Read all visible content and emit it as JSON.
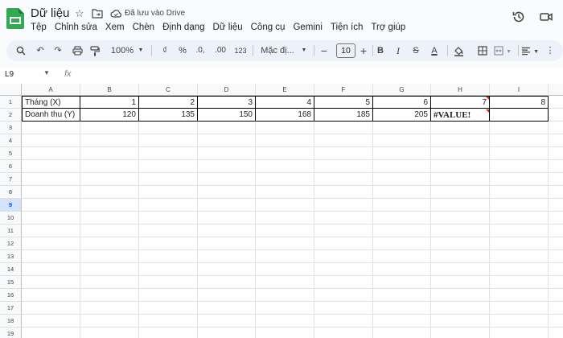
{
  "app": {
    "title": "Dữ liệu",
    "saved_status": "Đã lưu vào Drive",
    "icons": [
      "star-icon",
      "move-to-folder-icon",
      "cloud-saved-icon",
      "history-icon"
    ],
    "brand_color": "#34a853"
  },
  "menu": [
    "Tệp",
    "Chỉnh sửa",
    "Xem",
    "Chèn",
    "Định dạng",
    "Dữ liệu",
    "Công cụ",
    "Gemini",
    "Tiện ích",
    "Trợ giúp"
  ],
  "toolbar": {
    "zoom": "100%",
    "currency": "₫",
    "percent": "%",
    "decrease_decimal": ".0,",
    "increase_decimal": ".00",
    "number_format": "123",
    "font": "Mặc đị...",
    "font_size": "10",
    "bold": "B",
    "italic": "I",
    "strike": "S",
    "text_color": "A"
  },
  "formula_bar": {
    "name_box": "L9",
    "fx": "fx",
    "formula": ""
  },
  "grid": {
    "columns": [
      "A",
      "B",
      "C",
      "D",
      "E",
      "F",
      "G",
      "H",
      "I"
    ],
    "rows": [
      "1",
      "2",
      "3",
      "4",
      "5",
      "6",
      "7",
      "8",
      "9",
      "10",
      "11",
      "12",
      "13",
      "14",
      "15",
      "16",
      "17",
      "18",
      "19"
    ],
    "selected_row": "9",
    "data": [
      [
        "Tháng (X)",
        "1",
        "2",
        "3",
        "4",
        "5",
        "6",
        "7",
        "8"
      ],
      [
        "Doanh thu (Y)",
        "120",
        "135",
        "150",
        "168",
        "185",
        "205",
        "#VALUE!",
        ""
      ]
    ]
  }
}
